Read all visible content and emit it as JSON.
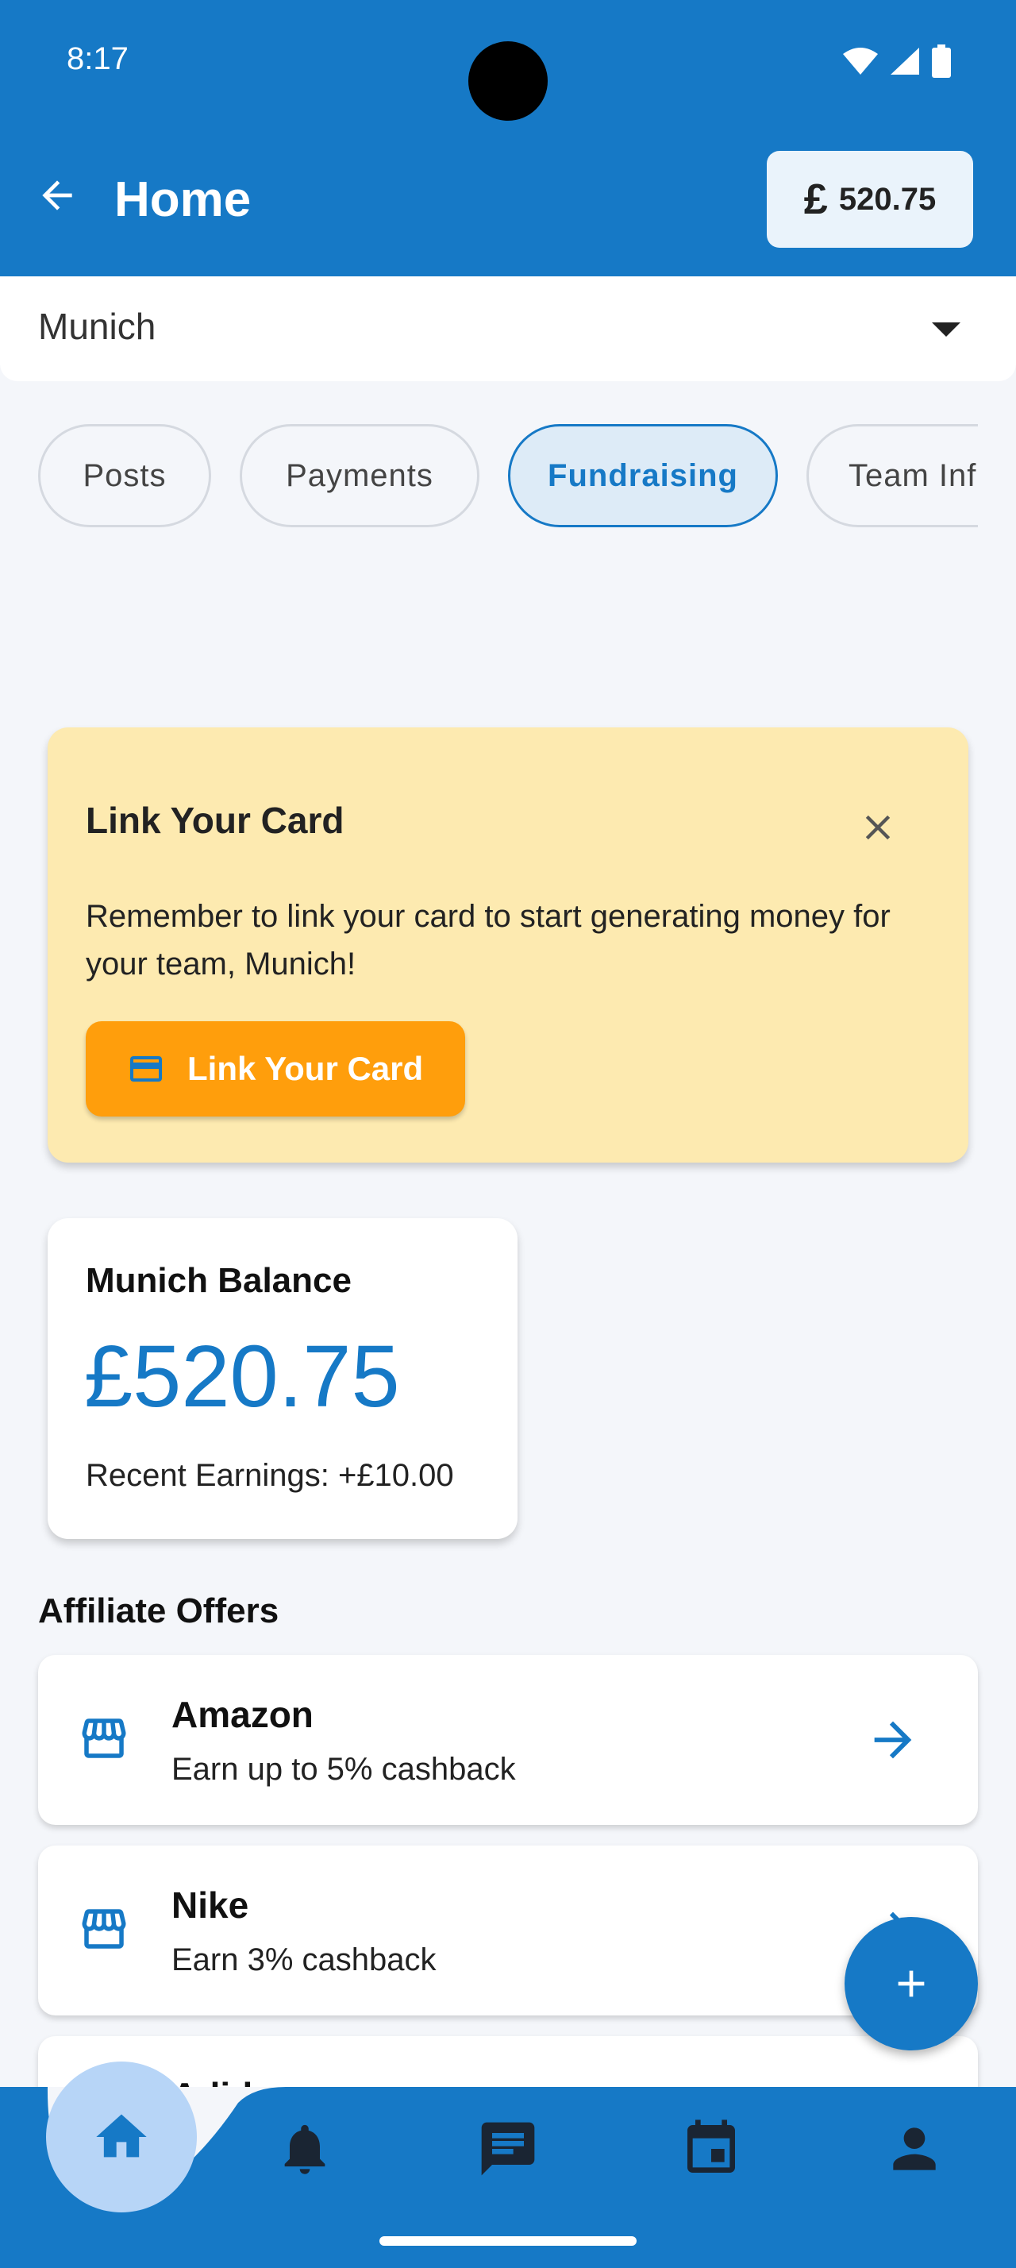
{
  "status_bar": {
    "time": "8:17"
  },
  "app_bar": {
    "title": "Home",
    "balance_symbol": "£",
    "balance": "520.75"
  },
  "team_selector": {
    "selected": "Munich"
  },
  "tabs": [
    {
      "label": "Posts",
      "active": false
    },
    {
      "label": "Payments",
      "active": false
    },
    {
      "label": "Fundraising",
      "active": true
    },
    {
      "label": "Team Info",
      "active": false
    }
  ],
  "banner": {
    "title": "Link Your Card",
    "body": "Remember to link your card to start generating money for your team, Munich!",
    "button_label": "Link Your Card"
  },
  "balance_card": {
    "label": "Munich Balance",
    "amount": "£520.75",
    "recent": "Recent Earnings: +£10.00"
  },
  "affiliate": {
    "section_title": "Affiliate Offers",
    "offers": [
      {
        "name": "Amazon",
        "desc": "Earn up to 5% cashback"
      },
      {
        "name": "Nike",
        "desc": "Earn 3% cashback"
      },
      {
        "name": "Adidas",
        "desc": ""
      }
    ]
  },
  "bottom_nav": {
    "items": [
      {
        "icon": "home-icon",
        "active": true
      },
      {
        "icon": "bell-icon",
        "active": false
      },
      {
        "icon": "chat-icon",
        "active": false
      },
      {
        "icon": "calendar-icon",
        "active": false
      },
      {
        "icon": "person-icon",
        "active": false
      }
    ]
  },
  "colors": {
    "primary": "#1679C6",
    "accent": "#FF9E0C",
    "banner_bg": "#FDEAB0",
    "page_bg": "#F4F6FA"
  }
}
